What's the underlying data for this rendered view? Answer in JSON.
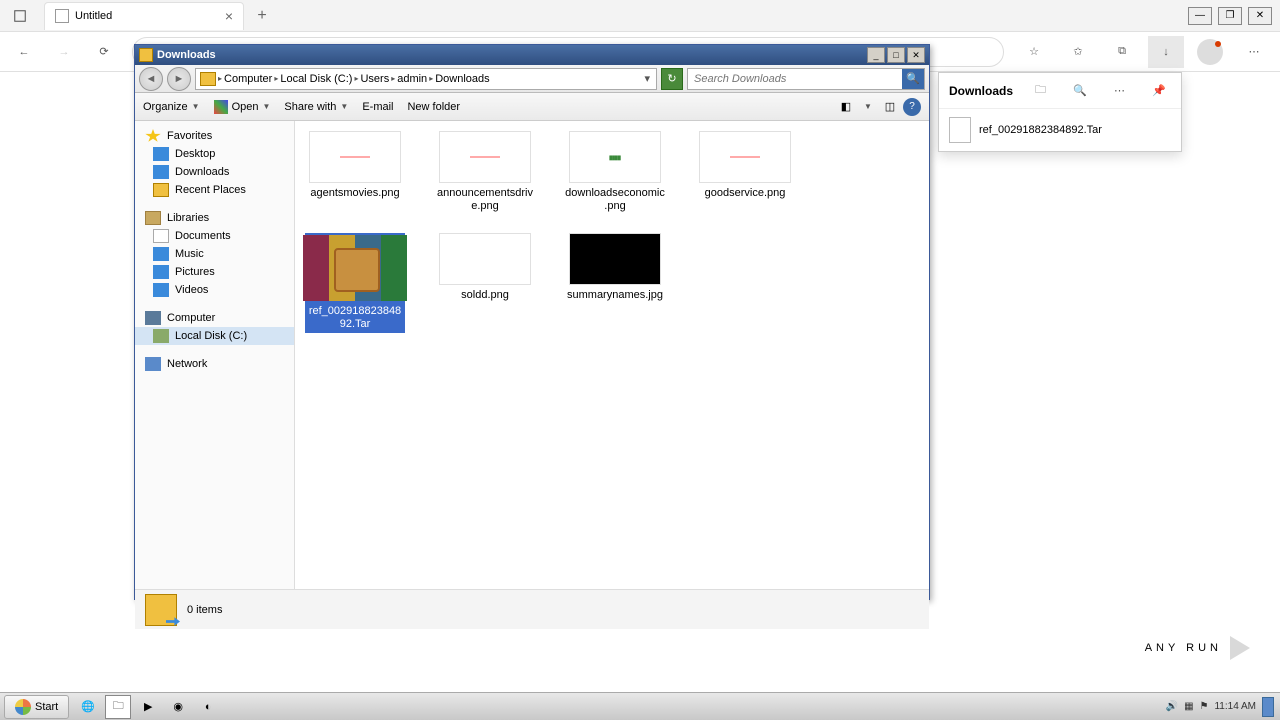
{
  "browser": {
    "tab_title": "Untitled",
    "downloads_label": "Downloads",
    "dl_filename": "ref_0029188238489​2.Tar"
  },
  "explorer": {
    "title": "Downloads",
    "crumbs": [
      "Computer",
      "Local Disk (C:)",
      "Users",
      "admin",
      "Downloads"
    ],
    "search_placeholder": "Search Downloads",
    "toolbar": {
      "organize": "Organize",
      "open": "Open",
      "share": "Share with",
      "email": "E-mail",
      "newfolder": "New folder"
    },
    "nav": {
      "favorites": "Favorites",
      "desktop": "Desktop",
      "downloads": "Downloads",
      "recent": "Recent Places",
      "libraries": "Libraries",
      "documents": "Documents",
      "music": "Music",
      "pictures": "Pictures",
      "videos": "Videos",
      "computer": "Computer",
      "localdisk": "Local Disk (C:)",
      "network": "Network"
    },
    "files": [
      {
        "name": "agentsmovies.png",
        "type": "img"
      },
      {
        "name": "announcementsdrive.png",
        "type": "img"
      },
      {
        "name": "downloadseconomic.png",
        "type": "img-green"
      },
      {
        "name": "goodservice.png",
        "type": "img"
      },
      {
        "name": "ref_0029188238489​2.Tar",
        "type": "rar",
        "selected": true
      },
      {
        "name": "soldd.png",
        "type": "img"
      },
      {
        "name": "summarynames.jpg",
        "type": "dark"
      }
    ],
    "status": "0 items"
  },
  "taskbar": {
    "start": "Start",
    "time": "11:14 AM"
  },
  "watermark": "ANY RUN"
}
